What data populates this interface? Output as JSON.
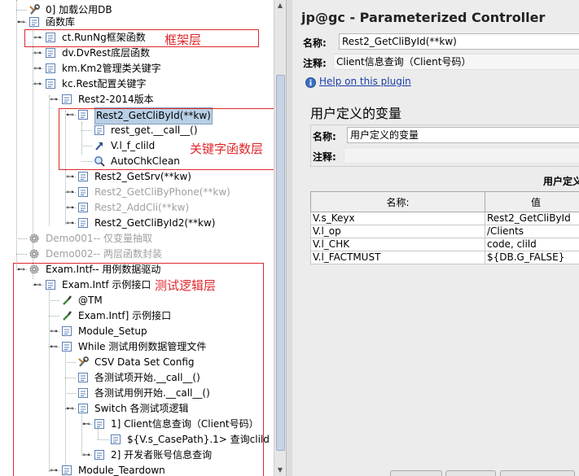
{
  "tree": {
    "items": [
      {
        "label": "0] 加载公用DB",
        "icon": "wrench-icon",
        "state": "normal"
      },
      {
        "label": "函数库",
        "icon": "controller-icon",
        "state": "normal"
      },
      {
        "label": "ct.RunNg框架函数",
        "icon": "controller-icon",
        "state": "normal"
      },
      {
        "label": "dv.DvRest底层函数",
        "icon": "controller-icon",
        "state": "normal"
      },
      {
        "label": "km.Km2管理类关键字",
        "icon": "controller-icon",
        "state": "normal"
      },
      {
        "label": "kc.Rest配置关键字",
        "icon": "controller-icon",
        "state": "normal"
      },
      {
        "label": "Rest2-2014版本",
        "icon": "controller-icon",
        "state": "normal"
      },
      {
        "label": "Rest2_GetCliById(**kw)",
        "icon": "controller-icon",
        "state": "selected"
      },
      {
        "label": "rest_get.__call__()",
        "icon": "controller-icon",
        "state": "normal"
      },
      {
        "label": "V.l_f_clild",
        "icon": "arrow-icon",
        "state": "normal"
      },
      {
        "label": "AutoChkClean",
        "icon": "magnifier-icon",
        "state": "normal"
      },
      {
        "label": "Rest2_GetSrv(**kw)",
        "icon": "controller-icon",
        "state": "normal"
      },
      {
        "label": "Rest2_GetCliByPhone(**kw)",
        "icon": "controller-icon",
        "state": "disabled"
      },
      {
        "label": "Rest2_AddCli(**kw)",
        "icon": "controller-icon",
        "state": "disabled"
      },
      {
        "label": "Rest2_GetCliById2(**kw)",
        "icon": "controller-icon",
        "state": "normal"
      },
      {
        "label": "Demo001-- 仅变量抽取",
        "icon": "gear-icon",
        "state": "disabled"
      },
      {
        "label": "Demo002-- 两层函数封装",
        "icon": "gear-icon",
        "state": "disabled"
      },
      {
        "label": "Exam.Intf-- 用例数据驱动",
        "icon": "gear-icon",
        "state": "normal"
      },
      {
        "label": "Exam.Intf 示例接口",
        "icon": "controller-icon",
        "state": "normal"
      },
      {
        "label": "@TM",
        "icon": "pipette-icon",
        "state": "normal"
      },
      {
        "label": "Exam.Intf] 示例接口",
        "icon": "pipette-icon",
        "state": "normal"
      },
      {
        "label": "Module_Setup",
        "icon": "controller-icon",
        "state": "normal"
      },
      {
        "label": "While 测试用例数据管理文件",
        "icon": "controller-icon",
        "state": "normal"
      },
      {
        "label": "CSV Data Set Config",
        "icon": "wrench-icon",
        "state": "normal"
      },
      {
        "label": "各测试项开始.__call__()",
        "icon": "controller-icon",
        "state": "normal"
      },
      {
        "label": "各测试用例开始.__call__()",
        "icon": "controller-icon",
        "state": "normal"
      },
      {
        "label": "Switch 各测试项逻辑",
        "icon": "controller-icon",
        "state": "normal"
      },
      {
        "label": "1] Client信息查询（Client号码）",
        "icon": "controller-icon",
        "state": "normal"
      },
      {
        "label": "${V.s_CasePath}.1> 查询clild",
        "icon": "controller-icon",
        "state": "normal"
      },
      {
        "label": "2] 开发者账号信息查询",
        "icon": "controller-icon",
        "state": "normal"
      },
      {
        "label": "Module_Teardown",
        "icon": "controller-icon",
        "state": "normal"
      }
    ]
  },
  "annotations": {
    "framework_layer": "框架层",
    "keyword_layer": "关键字函数层",
    "logic_layer": "测试逻辑层"
  },
  "panel": {
    "title": "jp@gc - Parameterized Controller",
    "name_label": "名称:",
    "name_value": "Rest2_GetCliById(**kw)",
    "comment_label": "注释:",
    "comment_value": "Client信息查询（Client号码）",
    "help_link": "Help on this plugin",
    "section_title": "用户定义的变量",
    "inner_name_label": "名称:",
    "inner_name_value": "用户定义的变量",
    "inner_comment_label": "注释:",
    "inner_comment_value": "",
    "table_caption": "用户定义",
    "table_headers": [
      "名称:",
      "值"
    ],
    "rows": [
      {
        "name": "V.s_Keyx",
        "value": "Rest2_GetCliById"
      },
      {
        "name": "V.l_op",
        "value": "/Clients"
      },
      {
        "name": "V.l_CHK",
        "value": "code, clild"
      },
      {
        "name": "V.l_FACTMUST",
        "value": "${DB.G_FALSE}"
      }
    ]
  },
  "colors": {
    "annotation_red": "#e0282c",
    "selection": "#b8cfe5",
    "link": "#1a3ea8"
  }
}
